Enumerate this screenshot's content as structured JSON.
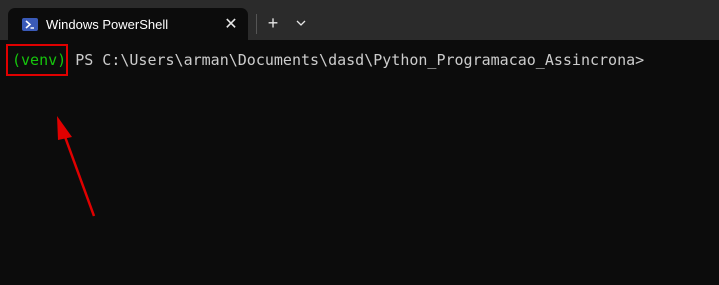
{
  "tab": {
    "title": "Windows PowerShell",
    "icon": "powershell-icon",
    "close_glyph": "✕"
  },
  "titlebar": {
    "new_tab_glyph": "+",
    "dropdown_icon": "chevron-down-icon"
  },
  "terminal": {
    "venv": "(venv)",
    "prompt": "PS C:\\Users\\arman\\Documents\\dasd\\Python_Programacao_Assincrona>"
  },
  "colors": {
    "venv_green": "#16c60c",
    "annotation_red": "#e00000",
    "background": "#0c0c0c"
  }
}
